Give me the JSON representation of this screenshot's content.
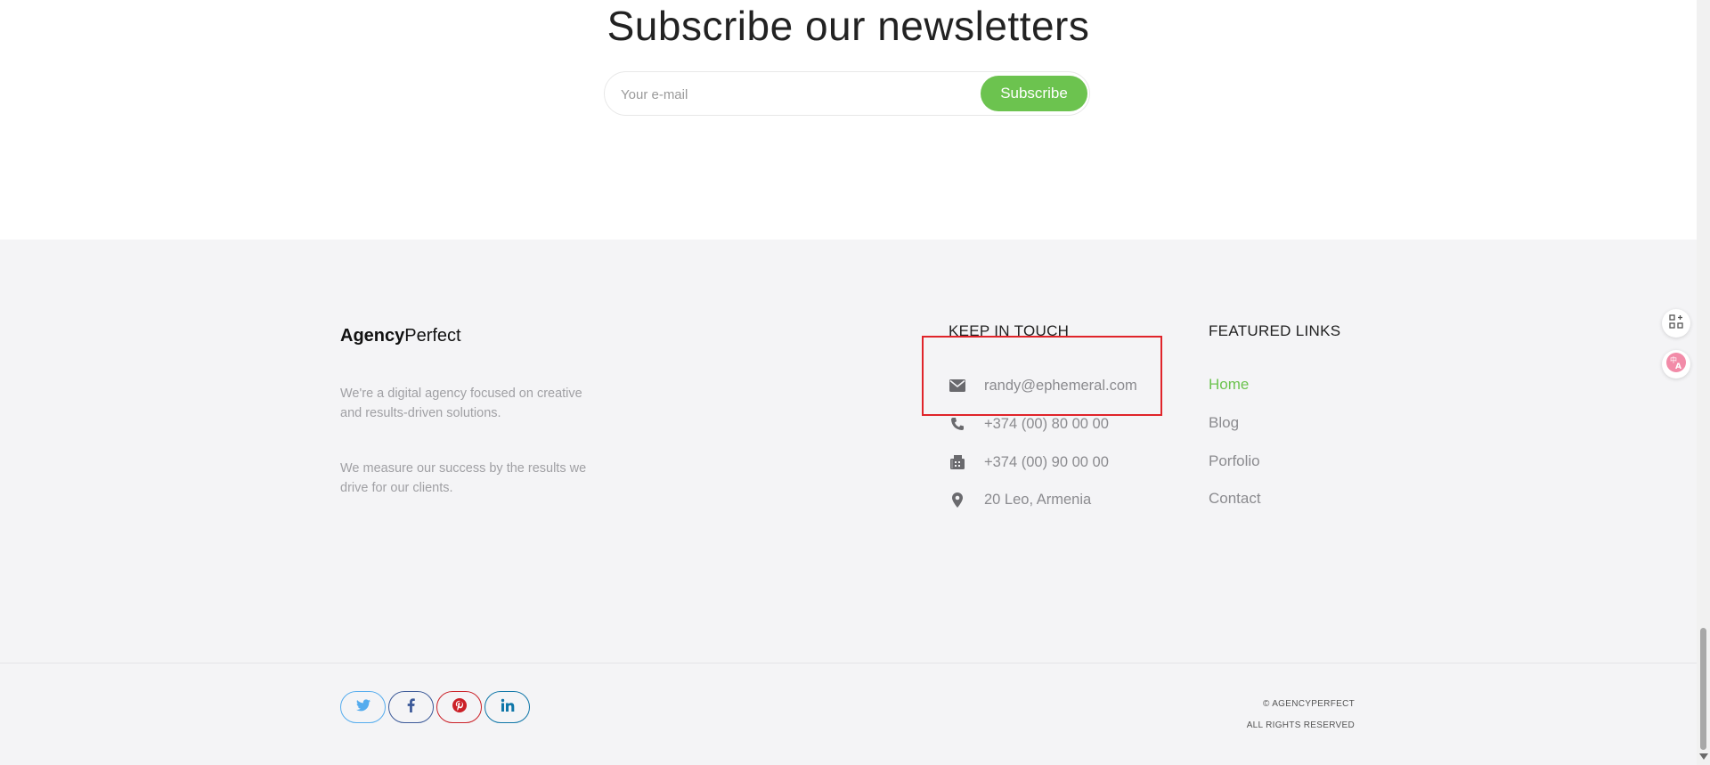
{
  "newsletter": {
    "title": "Subscribe our newsletters",
    "email_placeholder": "Your e-mail",
    "button_label": "Subscribe"
  },
  "footer": {
    "brand_bold": "Agency",
    "brand_light": "Perfect",
    "description_1": "We're a digital agency focused on creative and results-driven solutions.",
    "description_2": "We measure our success by the results we drive for our clients.",
    "keep_in_touch": {
      "title": "KEEP IN TOUCH",
      "items": [
        {
          "icon": "envelope-icon",
          "text": "randy@ephemeral.com"
        },
        {
          "icon": "phone-icon",
          "text": "+374 (00) 80 00 00"
        },
        {
          "icon": "fax-icon",
          "text": "+374 (00) 90 00 00"
        },
        {
          "icon": "location-pin-icon",
          "text": "20 Leo, Armenia"
        }
      ]
    },
    "featured_links": {
      "title": "FEATURED LINKS",
      "items": [
        {
          "label": "Home",
          "active": true
        },
        {
          "label": "Blog",
          "active": false
        },
        {
          "label": "Porfolio",
          "active": false
        },
        {
          "label": "Contact",
          "active": false
        }
      ]
    },
    "social": [
      {
        "icon": "twitter-icon",
        "color": "#55acee"
      },
      {
        "icon": "facebook-icon",
        "color": "#3b5998"
      },
      {
        "icon": "pinterest-icon",
        "color": "#cb2027"
      },
      {
        "icon": "linkedin-icon",
        "color": "#0e76a8"
      }
    ],
    "copyright_line1": "© AGENCYPERFECT",
    "copyright_line2": "ALL RIGHTS RESERVED"
  },
  "colors": {
    "accent": "#6cc34f",
    "footer_bg": "#f4f4f6",
    "highlight_border": "#e0242a"
  },
  "widgets": [
    {
      "icon": "add-app-icon"
    },
    {
      "icon": "translate-icon"
    }
  ]
}
